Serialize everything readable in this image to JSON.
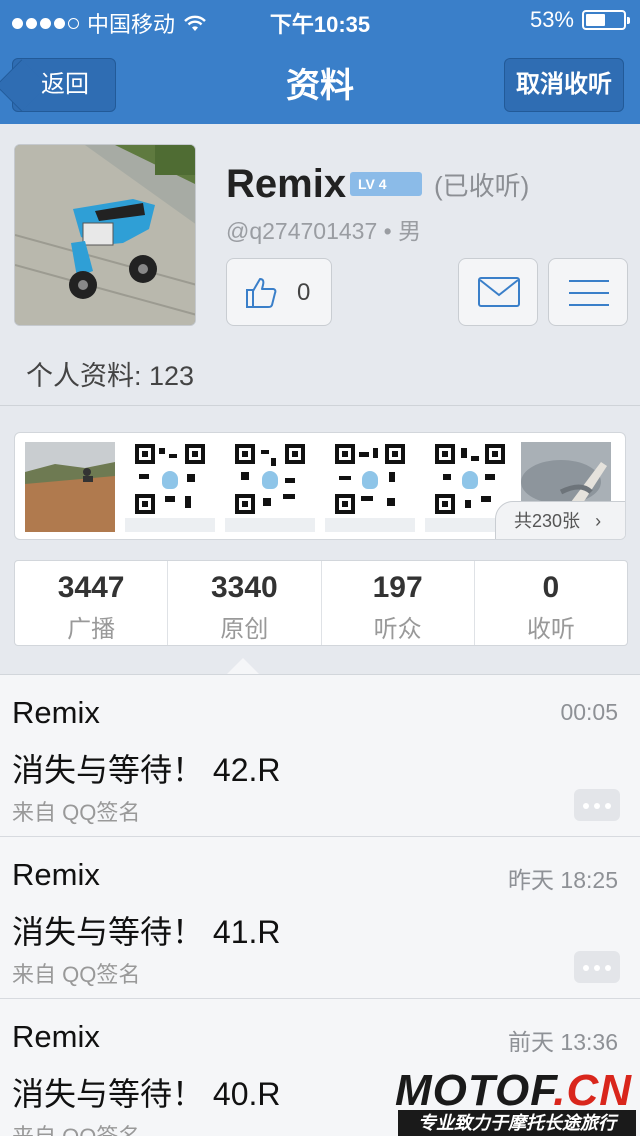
{
  "status_bar": {
    "carrier": "中国移动",
    "time": "下午10:35",
    "battery": "53%",
    "battery_level": 0.53
  },
  "nav": {
    "back_label": "返回",
    "title": "资料",
    "unfollow_label": "取消收听"
  },
  "profile": {
    "name": "Remix",
    "level": "LV 4",
    "follow_state": "(已收听)",
    "handle": "@q274701437 • 男",
    "likes": "0",
    "bio": "个人资料: 123"
  },
  "photos": {
    "more_label": "共230张"
  },
  "stats": [
    {
      "value": "3447",
      "label": "广播"
    },
    {
      "value": "3340",
      "label": "原创"
    },
    {
      "value": "197",
      "label": "听众"
    },
    {
      "value": "0",
      "label": "收听"
    }
  ],
  "posts": [
    {
      "name": "Remix",
      "time": "00:05",
      "text": "消失与等待！ 42.R",
      "source": "来自 QQ签名"
    },
    {
      "name": "Remix",
      "time": "昨天 18:25",
      "text": "消失与等待！ 41.R",
      "source": "来自 QQ签名"
    },
    {
      "name": "Remix",
      "time": "前天 13:36",
      "text": "消失与等待！ 40.R",
      "source": "来自 QQ签名"
    }
  ],
  "watermark": {
    "brand_main": "MOTOF",
    "brand_suffix": ".CN",
    "tagline": "专业致力于摩托长途旅行"
  },
  "colors": {
    "nav_blue": "#3a7fc9",
    "level_badge": "#8bbbe8",
    "watermark_red": "#d9261c"
  }
}
